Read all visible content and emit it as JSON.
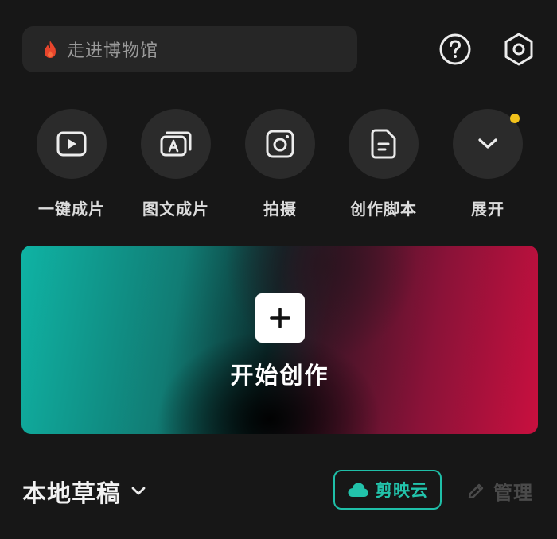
{
  "search": {
    "placeholder": "走进博物馆",
    "icon": "flame-icon"
  },
  "header_icons": {
    "help": "help-icon",
    "settings": "settings-hexagon-icon"
  },
  "shortcuts": [
    {
      "label": "一键成片",
      "icon": "play-box-icon"
    },
    {
      "label": "图文成片",
      "icon": "text-to-video-icon"
    },
    {
      "label": "拍摄",
      "icon": "camera-icon"
    },
    {
      "label": "创作脚本",
      "icon": "document-icon"
    },
    {
      "label": "展开",
      "icon": "chevron-down-icon",
      "has_badge": true
    }
  ],
  "create": {
    "label": "开始创作",
    "icon": "plus-icon"
  },
  "bottom": {
    "drafts_label": "本地草稿",
    "cloud_label": "剪映云",
    "manage_label": "管理"
  },
  "colors": {
    "background": "#171717",
    "accent_teal": "#22c3ab",
    "badge_yellow": "#f2c21b",
    "gradient_left": "#0fb3a4",
    "gradient_right": "#c9103f"
  }
}
